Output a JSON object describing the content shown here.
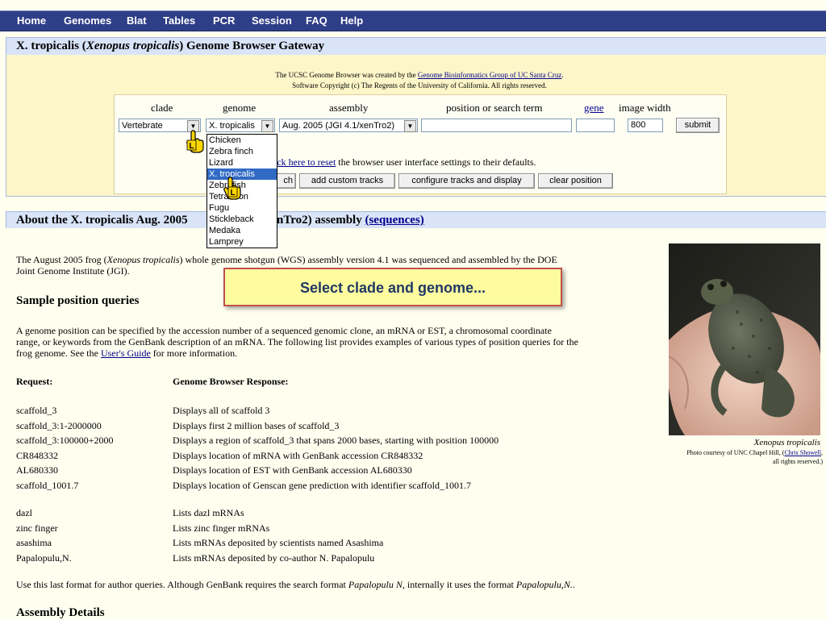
{
  "nav": {
    "items": [
      "Home",
      "Genomes",
      "Blat",
      "Tables",
      "PCR",
      "Session",
      "FAQ",
      "Help"
    ]
  },
  "gateway": {
    "title_prefix": "X. tropicalis (",
    "title_italic": "Xenopus tropicalis",
    "title_suffix": ") Genome Browser Gateway",
    "credit_line1_prefix": "The UCSC Genome Browser was created by the ",
    "credit_line1_link": "Genome Bioinformatics Group of UC Santa Cruz",
    "credit_line1_suffix": ".",
    "credit_line2": "Software Copyright (c) The Regents of the University of California. All rights reserved."
  },
  "form": {
    "labels": {
      "clade": "clade",
      "genome": "genome",
      "assembly": "assembly",
      "position": "position or search term",
      "gene": "gene",
      "image_width": "image width"
    },
    "clade_value": "Vertebrate",
    "genome_value": "X. tropicalis",
    "assembly_value": "Aug. 2005 (JGI 4.1/xenTro2)",
    "position_value": "",
    "gene_value": "",
    "image_width_value": "800",
    "submit_label": "submit",
    "reset_text_link": "ick here to reset",
    "reset_text_rest": " the browser user interface settings to their defaults.",
    "search_btn_label": "ch",
    "add_custom_tracks_label": "add custom tracks",
    "configure_tracks_label": "configure tracks and display",
    "clear_position_label": "clear position"
  },
  "genome_dropdown": {
    "options": [
      "Chicken",
      "Zebra finch",
      "Lizard",
      "X. tropicalis",
      "Zebrafish",
      "Tetraodon",
      "Fugu",
      "Stickleback",
      "Medaka",
      "Lamprey"
    ],
    "highlighted_index": 3
  },
  "cursor_badge": "L",
  "about": {
    "title_prefix": "About the X. tropicalis Aug. 2005",
    "title_mid": "nTro2) assembly ",
    "title_link": "(sequences)",
    "intro_a": "The August 2005 frog (",
    "intro_italic": "Xenopus tropicalis",
    "intro_b": ") whole genome shotgun (WGS) assembly version 4.1 was sequenced and assembled by the DOE",
    "intro_c": "Joint Genome Institute (JGI).",
    "sample_heading": "Sample position queries",
    "sample_para_1": "A genome position can be specified by the accession number of a sequenced genomic clone, an mRNA or EST, a chromosomal coordinate",
    "sample_para_2": "range, or keywords from the GenBank description of an mRNA. The following list provides examples of various types of position queries for the",
    "sample_para_3a": "frog genome. See the ",
    "sample_para_link": "User's Guide",
    "sample_para_3b": " for more information.",
    "col_request": "Request:",
    "col_response": "Genome Browser Response:",
    "rows_a": [
      [
        "scaffold_3",
        "Displays all of scaffold 3"
      ],
      [
        "scaffold_3:1-2000000",
        "Displays first 2 million bases of scaffold_3"
      ],
      [
        "scaffold_3:100000+2000",
        "Displays a region of scaffold_3 that spans 2000 bases, starting with position 100000"
      ],
      [
        "CR848332",
        "Displays location of mRNA with GenBank accession CR848332"
      ],
      [
        "AL680330",
        "Displays location of EST with GenBank accession AL680330"
      ],
      [
        "scaffold_1001.7",
        "Displays location of Genscan gene prediction with identifier scaffold_1001.7"
      ]
    ],
    "rows_b": [
      [
        "dazl",
        "Lists dazl mRNAs"
      ],
      [
        "zinc finger",
        "Lists zinc finger mRNAs"
      ],
      [
        "asashima",
        "Lists mRNAs deposited by scientists named Asashima"
      ],
      [
        "Papalopulu,N.",
        "Lists mRNAs deposited by co-author N. Papalopulu"
      ]
    ],
    "author_note_a": "Use this last format for author queries. Although GenBank requires the search format ",
    "author_note_i1": "Papalopulu N",
    "author_note_b": ", internally it uses the format ",
    "author_note_i2": "Papalopulu,N.",
    "author_note_c": ".",
    "assembly_heading": "Assembly Details"
  },
  "photo": {
    "caption_italic": "Xenopus tropicalis",
    "credit_prefix": "Photo courtesy of UNC Chapel Hill, (",
    "credit_link": "Chris Showell",
    "credit_suffix": ",",
    "credit_line2": "all rights reserved.)"
  },
  "callout": {
    "text": "Select clade and genome..."
  },
  "colors": {
    "nav_bg": "#2e3e87",
    "header_bar": "#d9e4f8",
    "panel_bg": "#fdf6c9",
    "callout_bg": "#fffca0",
    "callout_border": "#c0504d",
    "selection": "#316ac5"
  }
}
